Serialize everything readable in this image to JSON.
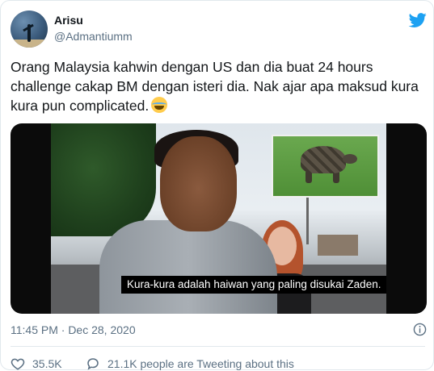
{
  "author": {
    "name": "Arisu",
    "handle": "@Admantiumm"
  },
  "tweet": {
    "text": "Orang Malaysia kahwin dengan US dan dia buat 24 hours challenge cakap BM dengan isteri dia. Nak ajar apa maksud kura kura pun complicated.",
    "emoji": "joy-emoji"
  },
  "media": {
    "subtitle": "Kura-kura adalah haiwan yang paling disukai Zaden."
  },
  "meta": {
    "timestamp": "11:45 PM · Dec 28, 2020"
  },
  "actions": {
    "likes": "35.5K",
    "tweeting": "21.1K people are Tweeting about this"
  },
  "colors": {
    "twitter_blue": "#1da1f2",
    "secondary_text": "#5b7083",
    "border": "#e1e8ed"
  },
  "icons": [
    "twitter-bird-icon",
    "info-icon",
    "heart-icon",
    "comment-icon"
  ]
}
